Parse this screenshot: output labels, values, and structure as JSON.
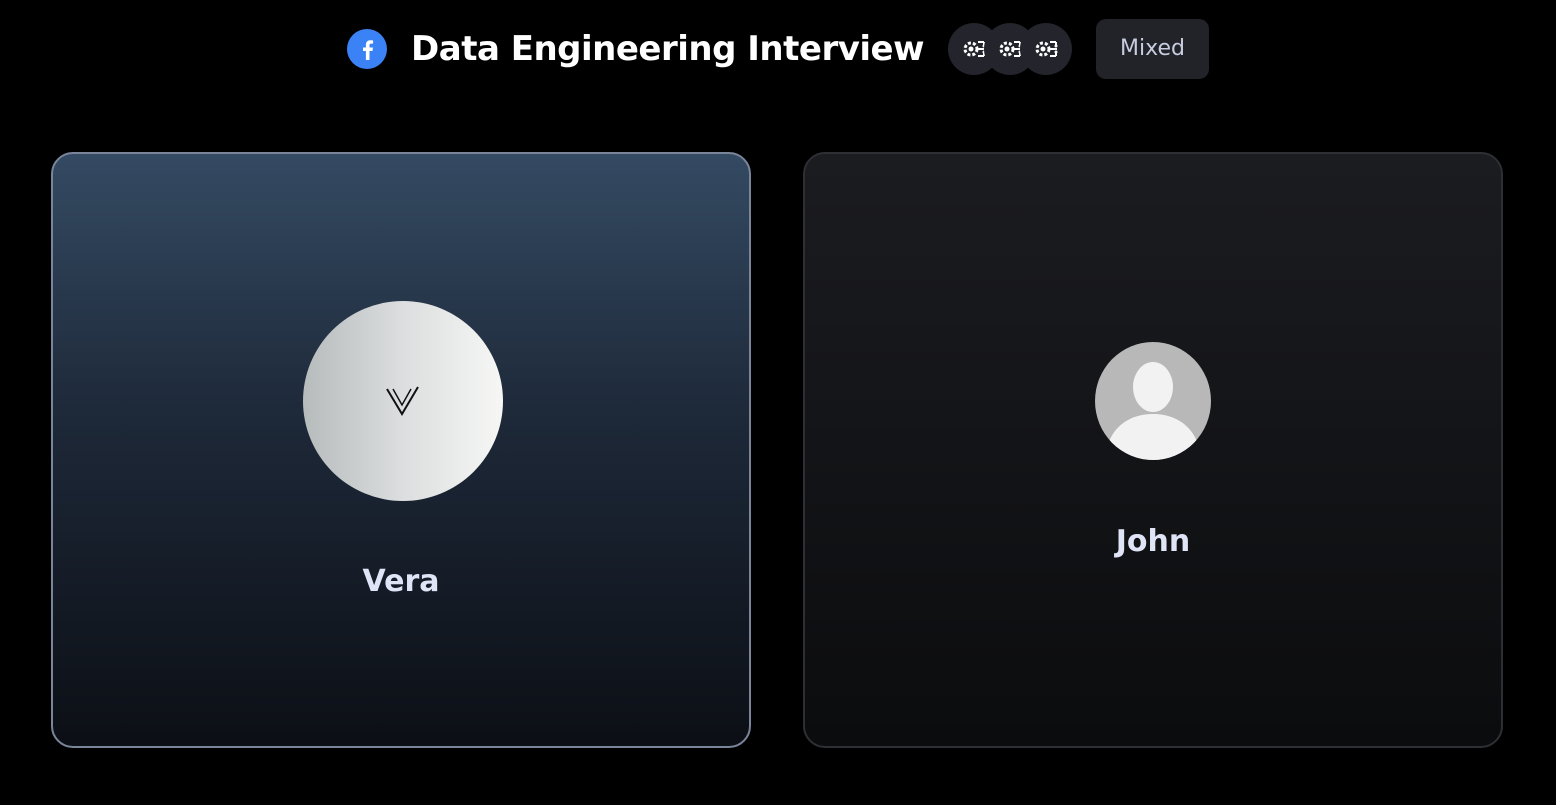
{
  "header": {
    "logo_icon": "facebook-icon",
    "title": "Data Engineering Interview",
    "skill_icons": [
      "gear-circuit-icon",
      "gear-circuit-icon",
      "gear-circuit-icon"
    ],
    "mode_label": "Mixed"
  },
  "participants": [
    {
      "name": "Vera",
      "avatar": "vera-logo",
      "active": true
    },
    {
      "name": "John",
      "avatar": "default-user-avatar",
      "active": false
    }
  ],
  "colors": {
    "background": "#000000",
    "facebook_blue": "#3b82f6",
    "active_border": "#7a859a",
    "name_text": "#dfe4f7"
  }
}
